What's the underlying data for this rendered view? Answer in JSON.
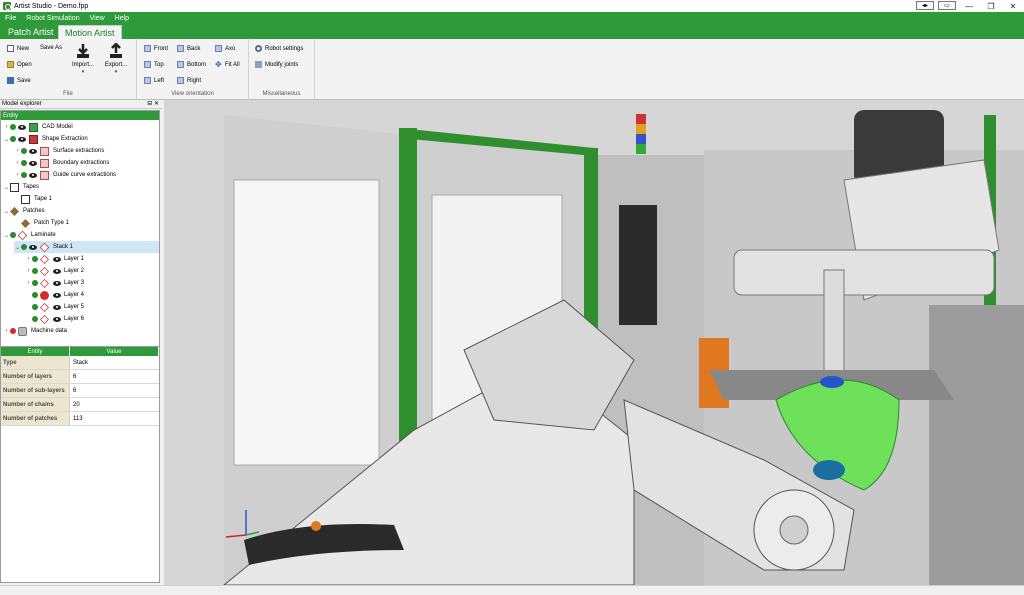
{
  "window": {
    "title": "Artist Studio - Demo.fpp",
    "buttons": [
      "◂▸",
      "▭",
      "—",
      "❐",
      "✕"
    ]
  },
  "menu": [
    "File",
    "Robot Simulation",
    "View",
    "Help"
  ],
  "tabs": [
    {
      "label": "Patch Artist",
      "active": false
    },
    {
      "label": "Motion Artist",
      "active": true
    }
  ],
  "ribbon": {
    "file": {
      "label": "File",
      "new": "New",
      "save_as": "Save As",
      "open": "Open",
      "save": "Save",
      "import": "Import...",
      "export": "Export..."
    },
    "view": {
      "label": "View orientation",
      "front": "Front",
      "back": "Back",
      "axo": "Axo",
      "top": "Top",
      "bottom": "Bottom",
      "fit_all": "Fit All",
      "left": "Left",
      "right": "Right"
    },
    "misc": {
      "label": "Miscellaneous",
      "robot_settings": "Robot settings",
      "modify_joints": "Modify joints"
    }
  },
  "explorer": {
    "title": "Model explorer",
    "header_buttons": "⊟ ✕",
    "column": "Entity",
    "nodes": [
      {
        "label": "CAD Model"
      },
      {
        "label": "Shape Extraction"
      },
      {
        "label": "Surface extractions"
      },
      {
        "label": "Boundary extractions"
      },
      {
        "label": "Guide curve extractions"
      },
      {
        "label": "Tapes"
      },
      {
        "label": "Tape 1"
      },
      {
        "label": "Patches"
      },
      {
        "label": "Patch Type 1"
      },
      {
        "label": "Laminate"
      },
      {
        "label": "Stack 1"
      },
      {
        "label": "Layer 1"
      },
      {
        "label": "Layer 2"
      },
      {
        "label": "Layer 3"
      },
      {
        "label": "Layer 4"
      },
      {
        "label": "Layer 5"
      },
      {
        "label": "Layer 6"
      },
      {
        "label": "Machine data"
      }
    ]
  },
  "properties": {
    "headers": [
      "Entity",
      "Value"
    ],
    "rows": [
      {
        "key": "Type",
        "value": "Stack"
      },
      {
        "key": "Number of layers",
        "value": "6"
      },
      {
        "key": "Number of sub-layers",
        "value": "6"
      },
      {
        "key": "Number of chains",
        "value": "20"
      },
      {
        "key": "Number of patches",
        "value": "113"
      }
    ]
  },
  "colors": {
    "accent": "#2e9a3a",
    "selection": "#cfe6f7",
    "mold": "#6ee05a",
    "robot": "#e8e8e8"
  }
}
